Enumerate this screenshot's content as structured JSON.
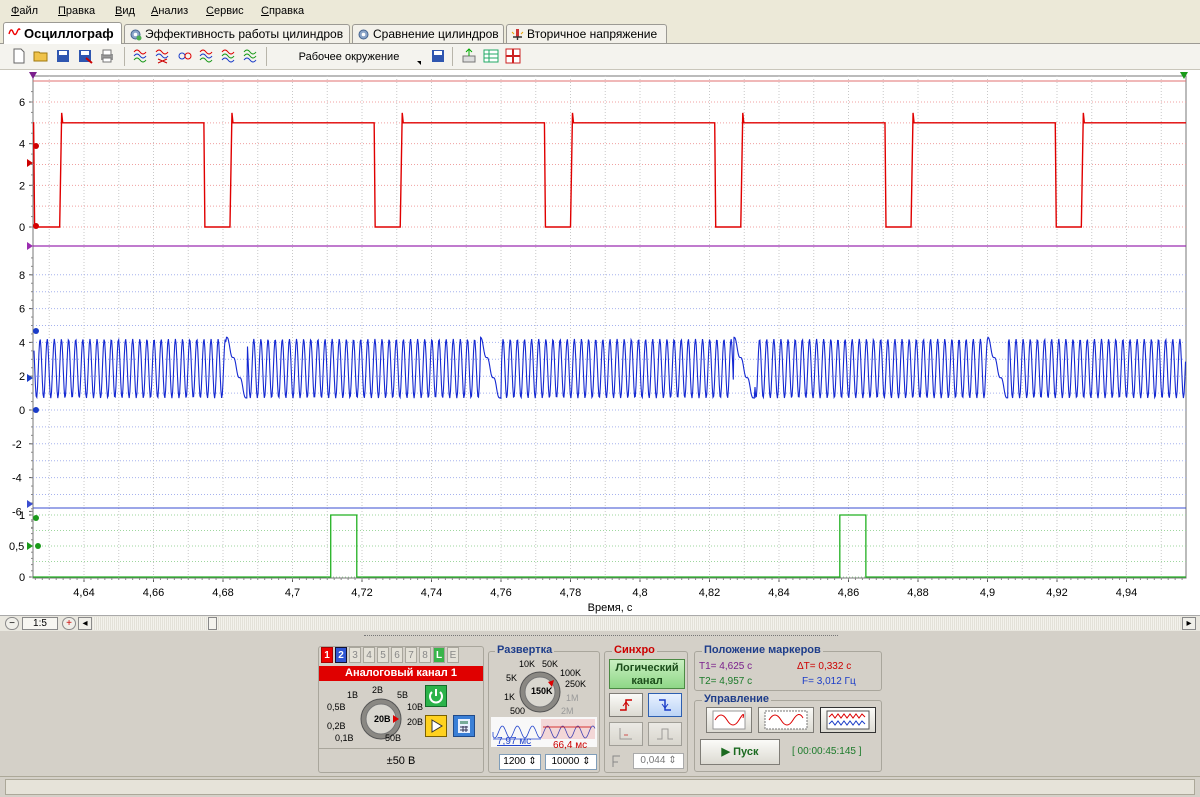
{
  "menu": [
    "Файл",
    "Правка",
    "Вид",
    "Анализ",
    "Сервис",
    "Справка"
  ],
  "tabs": [
    {
      "label": "Осциллограф",
      "active": true,
      "icon": "waveform-icon"
    },
    {
      "label": "Эффективность работы цилиндров",
      "active": false,
      "icon": "gear-icon"
    },
    {
      "label": "Сравнение цилиндров",
      "active": false,
      "icon": "gear-icon"
    },
    {
      "label": "Вторичное напряжение",
      "active": false,
      "icon": "spark-icon"
    }
  ],
  "toolbar": {
    "workspace_label": "Рабочее окружение",
    "icons": [
      "new-file-icon",
      "open-folder-icon",
      "save-icon",
      "save-as-icon",
      "print-icon",
      "channels-icon",
      "channels-multi-icon",
      "channels-xy-icon",
      "channels-sum-icon",
      "channels-a-icon",
      "channels-b-icon",
      "workspace-save-icon",
      "export-icon",
      "table-icon",
      "grid-icon"
    ]
  },
  "scope": {
    "x_axis_title": "Время, с",
    "x_ticks": [
      "4,64",
      "4,66",
      "4,68",
      "4,7",
      "4,72",
      "4,74",
      "4,76",
      "4,78",
      "4,8",
      "4,82",
      "4,84",
      "4,86",
      "4,88",
      "4,9",
      "4,92",
      "4,94"
    ],
    "pane1_ticks": [
      "6",
      "4",
      "2",
      "0"
    ],
    "pane2_ticks": [
      "8",
      "6",
      "4",
      "2",
      "0",
      "-2",
      "-4",
      "-6"
    ],
    "pane3_ticks": [
      "1",
      "0,5",
      "0"
    ],
    "colors": {
      "ch1": "#e00000",
      "ch2": "#1428d2",
      "ch3": "#20b020",
      "divider": "#9b2cb0"
    }
  },
  "scrollbar": {
    "zoom_label": "1:5"
  },
  "channel_panel": {
    "tabs": [
      "1",
      "2",
      "3",
      "4",
      "5",
      "6",
      "7",
      "8",
      "L",
      "E"
    ],
    "title": "Аналоговый канал 1",
    "knob_labels": [
      "2В",
      "1В",
      "5В",
      "0,5В",
      "10В",
      "20В",
      "0,2В",
      "20В",
      "0,1В",
      "50В"
    ],
    "range_label": "±50 В"
  },
  "timebase": {
    "title": "Развертка",
    "knob_labels": [
      "10K",
      "50K",
      "5K",
      "100K",
      "250K",
      "1K",
      "150K",
      "1M",
      "500",
      "2M"
    ],
    "interval_left": "7,97 мс",
    "interval_right": "66,4 мс",
    "spin_left": "1200",
    "spin_right": "10000"
  },
  "sync": {
    "title": "Синхро",
    "mode_label_line1": "Логический",
    "mode_label_line2": "канал",
    "level_value": "0,044"
  },
  "markers": {
    "title": "Положение маркеров",
    "t1": "T1= 4,625 с",
    "dt": "ΔT= 0,332 с",
    "t2": "T2= 4,957 с",
    "f": "F= 3,012 Гц"
  },
  "control": {
    "title": "Управление",
    "start_label": "Пуск",
    "timer": "[ 00:00:45:145 ]"
  }
}
